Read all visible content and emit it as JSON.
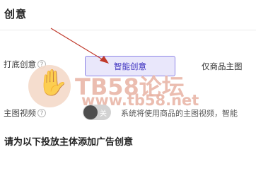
{
  "section": {
    "title": "创意"
  },
  "backing_creative": {
    "label": "打底创意",
    "help": "?",
    "options": [
      {
        "label": "智能创意",
        "selected": true
      },
      {
        "label": "仅商品主图",
        "selected": false
      }
    ]
  },
  "main_video": {
    "label": "主图视频",
    "help": "?",
    "toggle": {
      "text": "关",
      "on": false
    },
    "description": "系统将使用商品的主图视频，智能"
  },
  "add_creative": {
    "title": "请为以下投放主体添加广告创意"
  },
  "watermark": {
    "line1": "TB58论坛",
    "line2": "www.tb58.net"
  },
  "colors": {
    "accent": "#3b2fbf",
    "selected_bg": "#e9e7fb",
    "selected_border": "#8f86e6",
    "arrow": "#c0392b"
  }
}
